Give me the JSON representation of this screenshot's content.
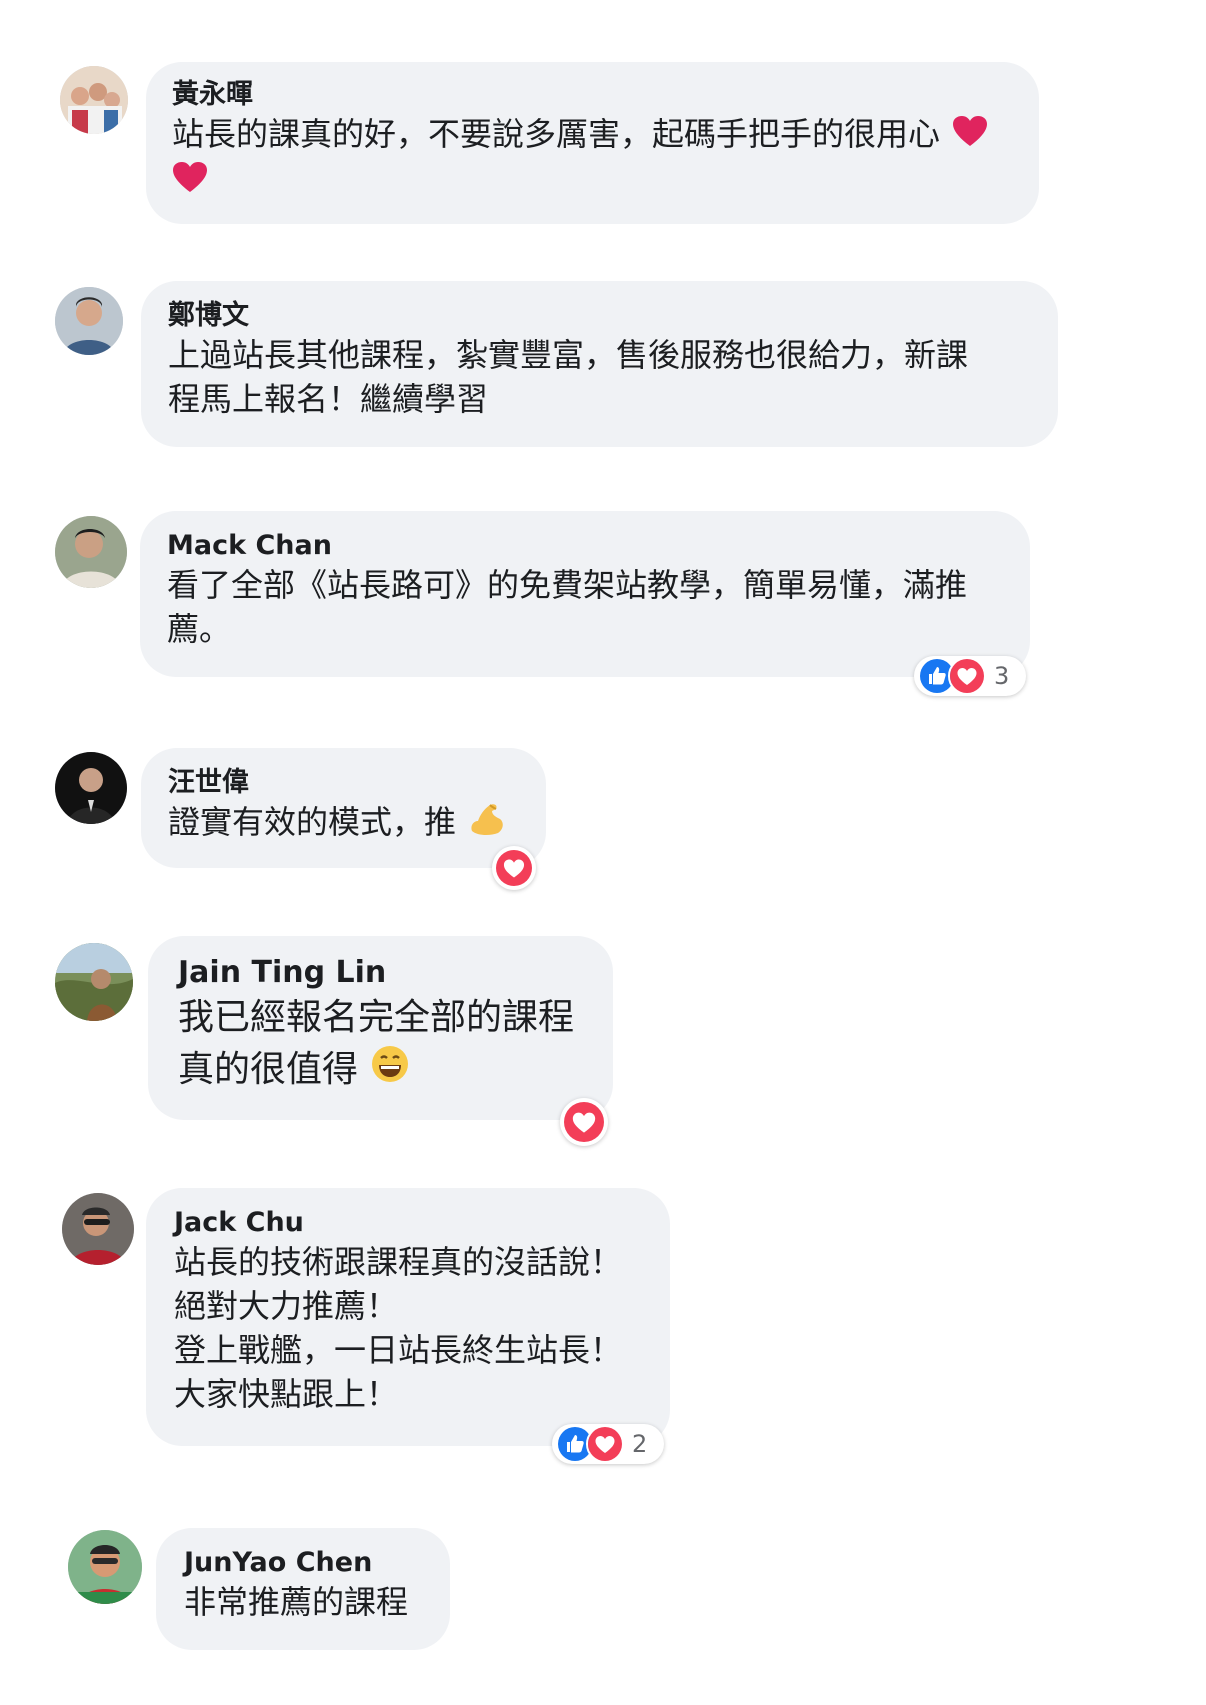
{
  "comments": [
    {
      "author": "黃永暉",
      "lines": [
        "站長的課真的好，不要說多厲害，起碼手把手的很用心",
        ""
      ],
      "emoji": "red-heart"
    },
    {
      "author": "鄭博文",
      "lines": [
        "上過站長其他課程，紮實豐富，售後服務也很給力，新課",
        "程馬上報名！繼續學習"
      ]
    },
    {
      "author": "Mack Chan",
      "lines": [
        "看了全部《站長路可》的免費架站教學，簡單易懂，滿推",
        "薦。"
      ],
      "reactions": {
        "icons": [
          "like",
          "love"
        ],
        "count": "3"
      }
    },
    {
      "author": "汪世偉",
      "lines": [
        "證實有效的模式，推"
      ],
      "emoji": "flexed-biceps",
      "reactions": {
        "icons": [
          "love"
        ]
      }
    },
    {
      "author": "Jain Ting Lin",
      "lines": [
        "我已經報名完全部的課程",
        "真的很值得"
      ],
      "emoji": "grinning-face",
      "reactions": {
        "icons": [
          "love"
        ]
      }
    },
    {
      "author": "Jack Chu",
      "lines": [
        "站長的技術跟課程真的沒話說！",
        "絕對大力推薦！",
        "登上戰艦，一日站長終生站長！",
        "大家快點跟上！"
      ],
      "reactions": {
        "icons": [
          "like",
          "love"
        ],
        "count": "2"
      }
    },
    {
      "author": "JunYao Chen",
      "lines": [
        "非常推薦的課程"
      ]
    }
  ],
  "colors": {
    "bubble": "#f0f2f5",
    "text": "#1c1e21",
    "secondary": "#65676b",
    "like_blue": "#1877f2",
    "love_red": "#f33e58",
    "heart_emoji": "#e0245e"
  }
}
